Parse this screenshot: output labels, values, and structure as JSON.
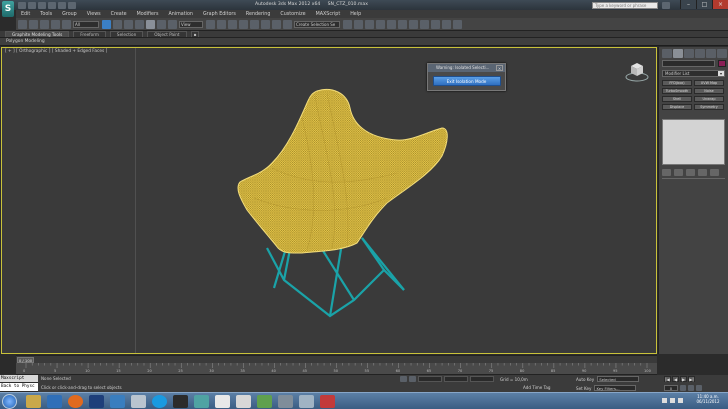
{
  "window": {
    "title": "Autodesk 3ds Max 2012 x64     SN_CTZ_010.max",
    "search_placeholder": "Type a keyword or phrase",
    "logo_glyph": "S",
    "minimize": "–",
    "maximize": "□",
    "close": "×"
  },
  "menu": [
    "Edit",
    "Tools",
    "Group",
    "Views",
    "Create",
    "Modifiers",
    "Animation",
    "Graph Editors",
    "Rendering",
    "Customize",
    "MAXScript",
    "Help"
  ],
  "toolbar": {
    "selection_filter": "All",
    "reference_coord": "View",
    "named_selection": "Create Selection Se"
  },
  "ribbon": {
    "tabs": [
      "Graphite Modeling Tools",
      "Freeform",
      "Selection",
      "Object Paint"
    ],
    "sub_label": "Polygon Modeling"
  },
  "viewport": {
    "label": "[ + ] [ Orthographic ] [ Shaded + Edged Faces ]"
  },
  "isolate_dialog": {
    "title": "Warning: Isolated Selecti...",
    "close": "×",
    "exit_button": "Exit Isolation Mode"
  },
  "command_panel": {
    "modifier_list": "Modifier List",
    "modifier_list_arrow": "▾",
    "modifier_buttons": [
      "FFD(box)",
      "UVW Map",
      "TurboSmooth",
      "Noise",
      "Shell",
      "Unwrap",
      "Displace",
      "Symmetry"
    ]
  },
  "timeline": {
    "frame_readout": "0 / 100",
    "ticks": [
      "0",
      "5",
      "10",
      "15",
      "20",
      "25",
      "30",
      "35",
      "40",
      "45",
      "50",
      "55",
      "60",
      "65",
      "70",
      "75",
      "80",
      "85",
      "90",
      "95",
      "100"
    ]
  },
  "status": {
    "maxscript_line1": "Maxscript",
    "maxscript_line2": "Back to Physc",
    "selection_status": "None Selected",
    "prompt": "Click or click-and-drag to select objects",
    "grid": "Grid = 10,0m",
    "add_time_tag": "Add Time Tag",
    "auto_key": "Auto Key",
    "set_key": "Set Key",
    "selected": "Selected",
    "key_filters": "Key Filters...",
    "frame": "0",
    "playback": [
      "|◀",
      "◀",
      "▶",
      "▶|"
    ]
  },
  "taskbar": {
    "time": "11:40 a.m.",
    "date": "06/11/2012"
  },
  "colors": {
    "accent": "#3b7fc4",
    "viewport_border": "#c9c23a",
    "chair_seat": "#e9c94a",
    "chair_frame": "#1aa3a8"
  }
}
